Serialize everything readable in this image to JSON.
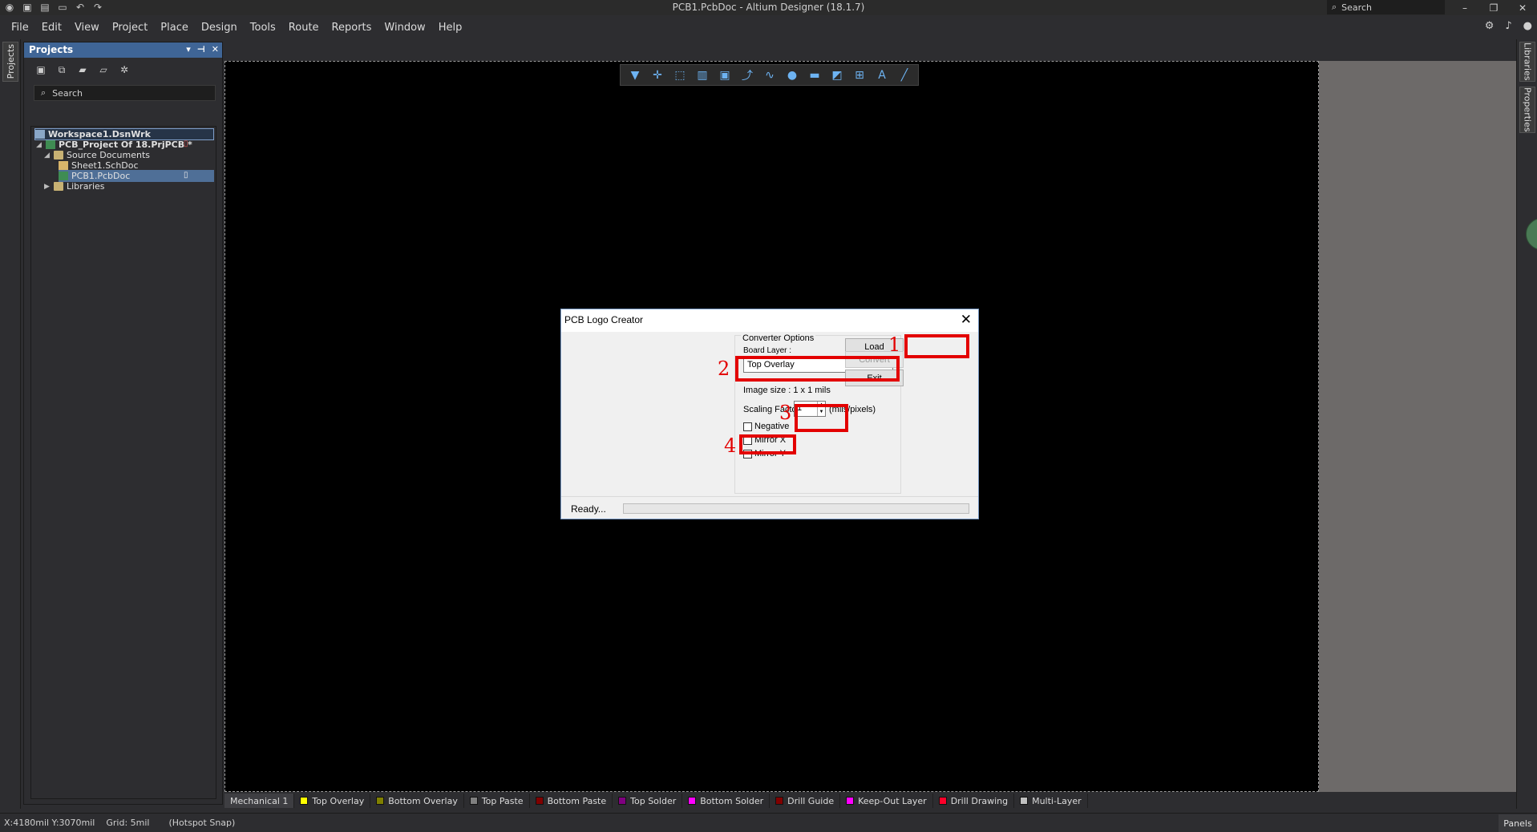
{
  "window": {
    "title": "PCB1.PcbDoc - Altium Designer (18.1.7)",
    "search_label": "Search"
  },
  "menu": {
    "items": [
      "File",
      "Edit",
      "View",
      "Project",
      "Place",
      "Design",
      "Tools",
      "Route",
      "Reports",
      "Window",
      "Help"
    ]
  },
  "left_strip": {
    "tab_label": "Projects"
  },
  "projects_panel": {
    "title": "Projects",
    "search_placeholder": "Search",
    "tree": {
      "workspace": "Workspace1.DsnWrk",
      "project": "PCB_Project Of 18.PrjPCB *",
      "source_folder": "Source Documents",
      "schematic": "Sheet1.SchDoc",
      "pcb": "PCB1.PcbDoc",
      "libraries": "Libraries"
    }
  },
  "right_strip": {
    "tabs": [
      "Libraries",
      "Properties"
    ]
  },
  "dialog": {
    "title": "PCB Logo Creator",
    "group_title": "Converter Options",
    "board_layer_label": "Board Layer :",
    "board_layer_value": "Top Overlay",
    "image_size": "Image size : 1 x 1 mils",
    "scaling_label": "Scaling Factor :",
    "scaling_value": "1",
    "scaling_unit": "(mils/pixels)",
    "checkboxes": {
      "negative": "Negative",
      "mirror_x": "Mirror X",
      "mirror_y": "Mirror Y"
    },
    "buttons": {
      "load": "Load",
      "convert": "Convert",
      "exit": "Exit"
    },
    "status": "Ready..."
  },
  "callouts": [
    "1",
    "2",
    "3",
    "4"
  ],
  "layers": [
    {
      "name": "Mechanical 1",
      "color": ""
    },
    {
      "name": "Top Overlay",
      "color": "#ffff00"
    },
    {
      "name": "Bottom Overlay",
      "color": "#808000"
    },
    {
      "name": "Top Paste",
      "color": "#808080"
    },
    {
      "name": "Bottom Paste",
      "color": "#800000"
    },
    {
      "name": "Top Solder",
      "color": "#800080"
    },
    {
      "name": "Bottom Solder",
      "color": "#ff00ff"
    },
    {
      "name": "Drill Guide",
      "color": "#800000"
    },
    {
      "name": "Keep-Out Layer",
      "color": "#ff00ff"
    },
    {
      "name": "Drill Drawing",
      "color": "#ff002a"
    },
    {
      "name": "Multi-Layer",
      "color": "#c0c0c0"
    }
  ],
  "status_bar": {
    "coords": "X:4180mil Y:3070mil",
    "grid": "Grid: 5mil",
    "snap": "(Hotspot Snap)",
    "panels": "Panels"
  }
}
